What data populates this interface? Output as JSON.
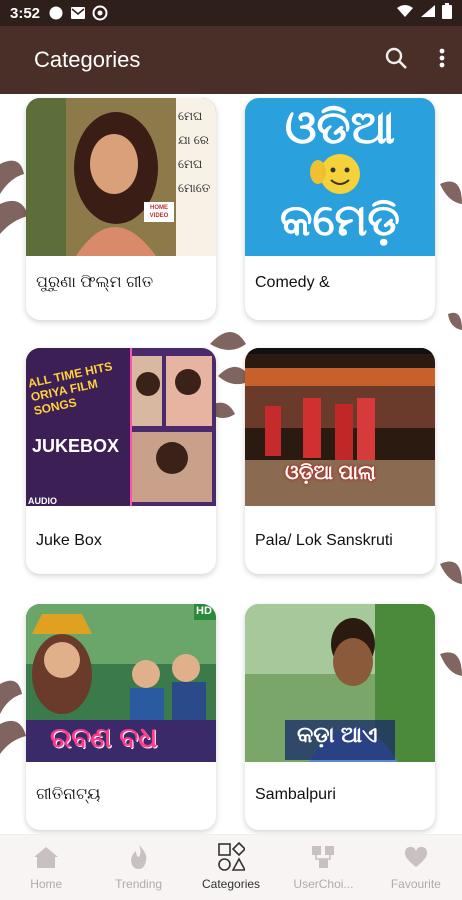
{
  "status_bar": {
    "time": "3:52"
  },
  "app_bar": {
    "title": "Categories"
  },
  "categories": [
    {
      "label": "ପୁରୁଣା ଫିଲ୍ମ ଗୀତ",
      "thumb_text": "ମେଘ ଯା ରେ ମେଘ ମୋତେ",
      "thumb_badge": "HOME VIDEO"
    },
    {
      "label": "Comedy &",
      "thumb_text_top": "ଓଡିଆ",
      "thumb_text_bottom": "କମେଡ଼ି"
    },
    {
      "label": "Juke Box",
      "thumb_text_top": "ALL TIME HITS ORIYA FILM SONGS",
      "thumb_text_bottom": "JUKEBOX",
      "thumb_badge": "AUDIO"
    },
    {
      "label": "Pala/ Lok Sanskruti",
      "thumb_text": "ଓଡ଼ିଆ ପାଲା"
    },
    {
      "label": "ଗୀତିନାଟ୍ୟ",
      "thumb_text": "ରବଣ ବଧ",
      "thumb_badge": "HD"
    },
    {
      "label": "Sambalpuri",
      "thumb_text": "କଡ଼ା ଆଏ"
    }
  ],
  "bottom_nav": [
    {
      "label": "Home",
      "icon": "home-icon",
      "active": false
    },
    {
      "label": "Trending",
      "icon": "flame-icon",
      "active": false
    },
    {
      "label": "Categories",
      "icon": "categories-icon",
      "active": true
    },
    {
      "label": "UserChoi...",
      "icon": "user-choice-icon",
      "active": false
    },
    {
      "label": "Favourite",
      "icon": "heart-icon",
      "active": false
    }
  ],
  "colors": {
    "status_bar": "#2f1f1a",
    "app_bar": "#4a2f28",
    "nav_bg": "#f7f4f3",
    "nav_inactive": "#b3aaa8",
    "nav_active": "#333333"
  }
}
